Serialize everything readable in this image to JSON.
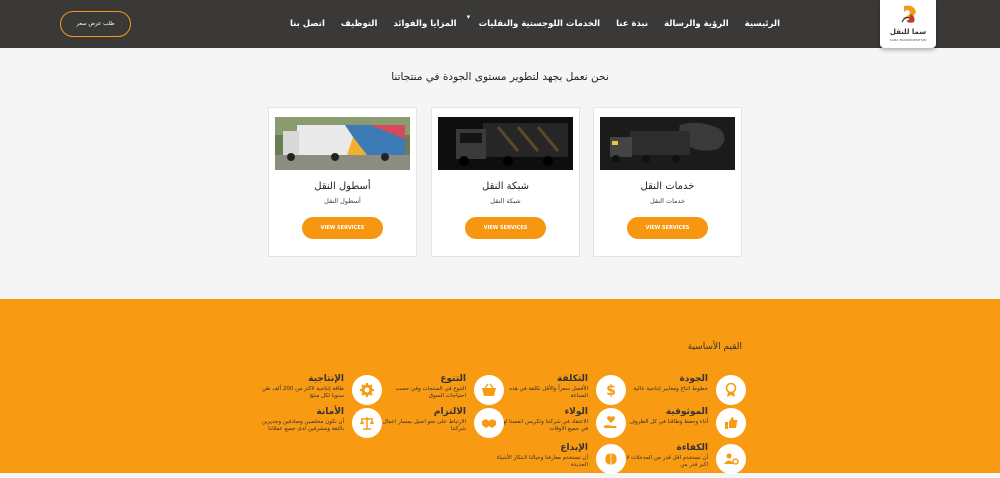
{
  "header": {
    "logo_text": "سما للنقل",
    "logo_sub": "SAMA TRANSPORTATION",
    "nav": [
      {
        "label": "الرئيسية"
      },
      {
        "label": "الرؤية والرسالة"
      },
      {
        "label": "نبذة عنا"
      },
      {
        "label": "الخدمات اللوجستية والنقليات",
        "caret": "▾"
      },
      {
        "label": "المزايا والفوائد"
      },
      {
        "label": "التوظيف"
      },
      {
        "label": "اتصل بنا"
      }
    ],
    "quote_button": "طلب عرض سعر"
  },
  "services": {
    "headline": "نحن نعمل بجهد لتطوير مستوى الجودة في منتجاتنا",
    "cards": [
      {
        "title": "خدمات النقل",
        "subtitle": "خدمات النقل",
        "button": "VIEW SERVICES"
      },
      {
        "title": "شبكة النقل",
        "subtitle": "شبكة النقل",
        "button": "VIEW SERVICES"
      },
      {
        "title": "أسطول النقل",
        "subtitle": "أسطول النقل",
        "button": "VIEW SERVICES"
      }
    ]
  },
  "values": {
    "title": "القيم الأساسية",
    "items": [
      {
        "title": "الجودة",
        "desc": "خطوط انتاج ومعايير إنتاجية عالية",
        "icon": "medal-icon"
      },
      {
        "title": "التكلفة",
        "desc": "الأفضل سعراً والأقل تكلفة في هذه الصناعة",
        "icon": "dollar-icon"
      },
      {
        "title": "التنوع",
        "desc": "التنوع في المنتجات وفي حسب احتياجات السوق",
        "icon": "basket-icon"
      },
      {
        "title": "الإنتاجية",
        "desc": "طاقة إنتاجية لاكثر من 200 ألف طن سنويا لكل منتج",
        "icon": "gear-icon"
      },
      {
        "title": "الموثوقية",
        "desc": "أداء وحفظ وطاقنا في كل الظروف",
        "icon": "thumbs-up-icon"
      },
      {
        "title": "الولاء",
        "desc": "الاعتقاد في شركتنا وتكريس انفسنا لها في جميع الأوقات",
        "icon": "hand-heart-icon"
      },
      {
        "title": "الالتزام",
        "desc": "الارتباط على نحو اصيل بمسار اعمال شركتنا",
        "icon": "handshake-icon"
      },
      {
        "title": "الأمانة",
        "desc": "أن نكون مخلصين وصادقين وجديرين بالثقة ومشرفين لدى جميع عملائنا",
        "icon": "scales-icon"
      },
      {
        "title": "الكفاءة",
        "desc": "أن نستخدم اقل قدر من المدخلات لانتاج اكبر قدر من",
        "icon": "users-gear-icon"
      },
      {
        "title": "الإبداع",
        "desc": "أن نستخدم معارفنا وخيالنا لابتكار الأشياء الجديدة",
        "icon": "brain-icon"
      }
    ]
  },
  "colors": {
    "header_bg": "#3a3937",
    "accent": "#f6970f",
    "values_bg": "#f89a12"
  }
}
